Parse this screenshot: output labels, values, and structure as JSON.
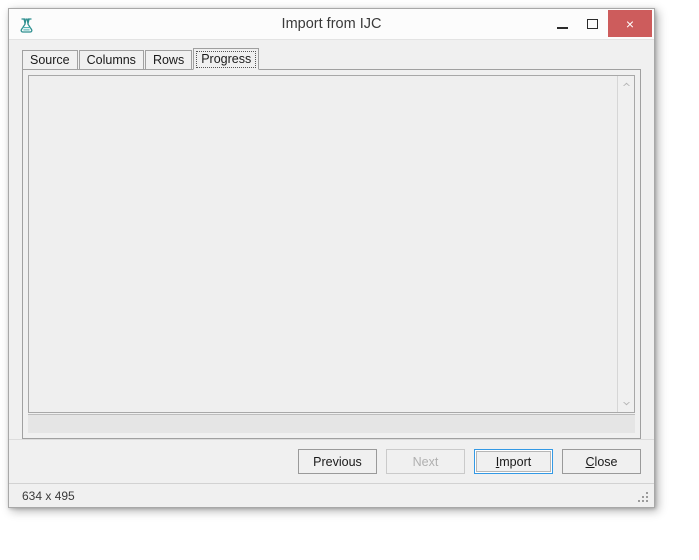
{
  "window": {
    "title": "Import from IJC",
    "app_icon": "beaker-w-icon",
    "controls": {
      "minimize_label": "Minimize",
      "maximize_label": "Maximize",
      "close_label": "×",
      "close_color": "#cd5c5c"
    }
  },
  "tabs": [
    {
      "label": "Source",
      "active": false
    },
    {
      "label": "Columns",
      "active": false
    },
    {
      "label": "Rows",
      "active": false
    },
    {
      "label": "Progress",
      "active": true
    }
  ],
  "content": {
    "text": "",
    "vertical_scrollbar": {
      "up_arrow": "chevron-up-icon",
      "down_arrow": "chevron-down-icon"
    }
  },
  "buttons": [
    {
      "label": "Previous",
      "mnemonic": "",
      "state": "normal"
    },
    {
      "label": "Next",
      "mnemonic": "",
      "state": "disabled"
    },
    {
      "label": "Import",
      "mnemonic": "I",
      "state": "focused"
    },
    {
      "label": "Close",
      "mnemonic": "C",
      "state": "normal"
    }
  ],
  "status": {
    "size_text": "634 x 495",
    "resize_grip": "resize-grip-icon"
  },
  "colors": {
    "accent_focus": "#3399e5",
    "close_button": "#cd5c5c",
    "window_bg": "#f0f0f0",
    "titlebar_bg": "#fcfcfc"
  }
}
